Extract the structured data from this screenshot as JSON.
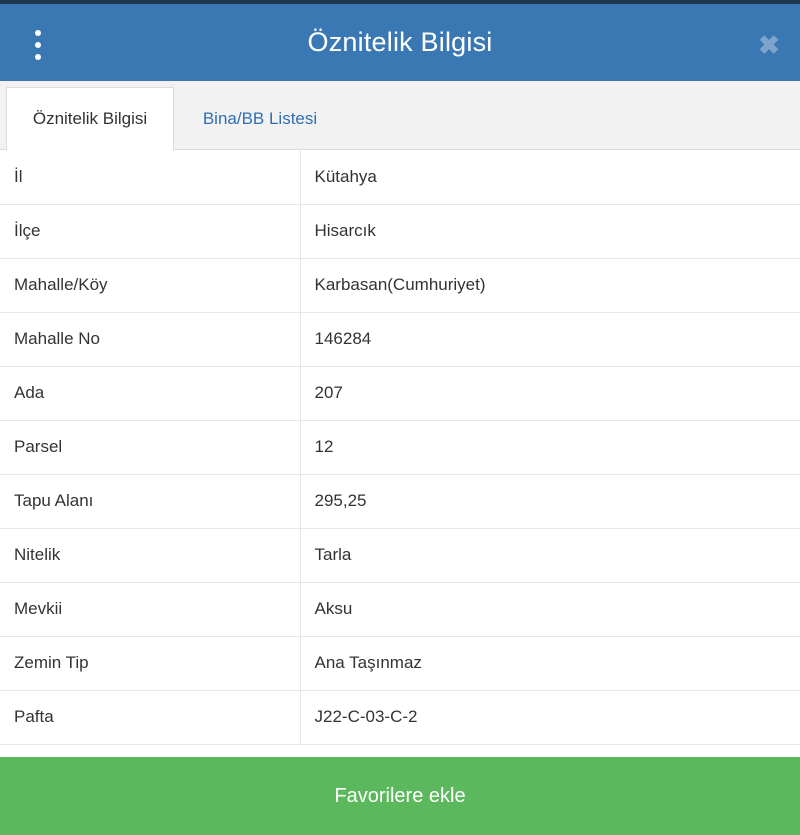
{
  "header": {
    "title": "Öznitelik Bilgisi",
    "menu_icon": "vertical-dots-icon",
    "close_icon": "close-icon",
    "color": "#3a78b4"
  },
  "tabs": [
    {
      "label": "Öznitelik Bilgisi",
      "active": true
    },
    {
      "label": "Bina/BB Listesi",
      "active": false
    }
  ],
  "attributes": [
    {
      "key": "İl",
      "value": "Kütahya"
    },
    {
      "key": "İlçe",
      "value": "Hisarcık"
    },
    {
      "key": "Mahalle/Köy",
      "value": "Karbasan(Cumhuriyet)"
    },
    {
      "key": "Mahalle No",
      "value": "146284"
    },
    {
      "key": "Ada",
      "value": "207"
    },
    {
      "key": "Parsel",
      "value": "12"
    },
    {
      "key": "Tapu Alanı",
      "value": "295,25"
    },
    {
      "key": "Nitelik",
      "value": "Tarla"
    },
    {
      "key": "Mevkii",
      "value": "Aksu"
    },
    {
      "key": "Zemin Tip",
      "value": "Ana Taşınmaz"
    },
    {
      "key": "Pafta",
      "value": "J22-C-03-C-2"
    }
  ],
  "footer": {
    "favorite_label": "Favorilere ekle",
    "color": "#5cb85c"
  }
}
